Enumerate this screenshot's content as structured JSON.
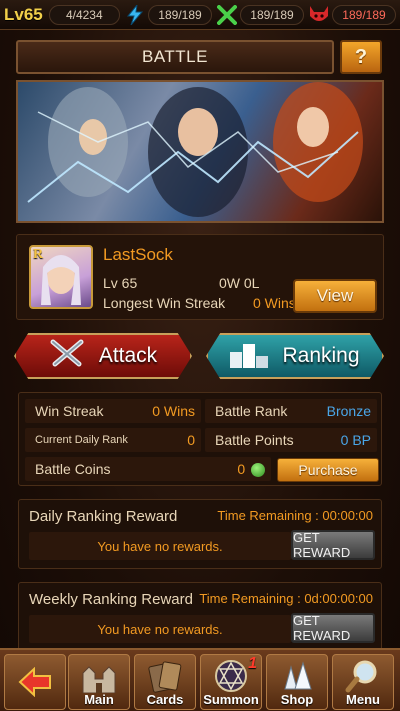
{
  "status": {
    "level": "Lv65",
    "exp": "4/4234",
    "energy": "189/189",
    "swords": "189/189",
    "demon": "189/189"
  },
  "header": {
    "title": "BATTLE",
    "help_label": "?"
  },
  "profile": {
    "rank_letter": "R",
    "name": "LastSock",
    "level": "Lv 65",
    "record": "0W 0L",
    "streak_label": "Longest Win Streak",
    "streak_value": "0 Wins",
    "view_label": "View"
  },
  "actions": {
    "attack_label": "Attack",
    "ranking_label": "Ranking"
  },
  "stats": {
    "win_streak_label": "Win Streak",
    "win_streak_value": "0 Wins",
    "battle_rank_label": "Battle Rank",
    "battle_rank_value": "Bronze",
    "daily_rank_label": "Current Daily Rank",
    "daily_rank_value": "0",
    "battle_points_label": "Battle Points",
    "battle_points_value": "0 BP",
    "coins_label": "Battle Coins",
    "coins_value": "0",
    "purchase_label": "Purchase"
  },
  "daily_reward": {
    "title": "Daily Ranking Reward",
    "time": "Time Remaining : 00:00:00",
    "message": "You have no rewards.",
    "button": "GET REWARD"
  },
  "weekly_reward": {
    "title": "Weekly Ranking Reward",
    "time": "Time Remaining : 0d:00:00:00",
    "message": "You have no rewards.",
    "button": "GET REWARD"
  },
  "nav": {
    "main": "Main",
    "cards": "Cards",
    "summon": "Summon",
    "summon_badge": "1",
    "shop": "Shop",
    "menu": "Menu"
  },
  "colors": {
    "accent_orange": "#f29a22",
    "rank_blue": "#4aa6e8",
    "attack_red": "#b8241a",
    "ranking_teal": "#2fa2a8"
  }
}
